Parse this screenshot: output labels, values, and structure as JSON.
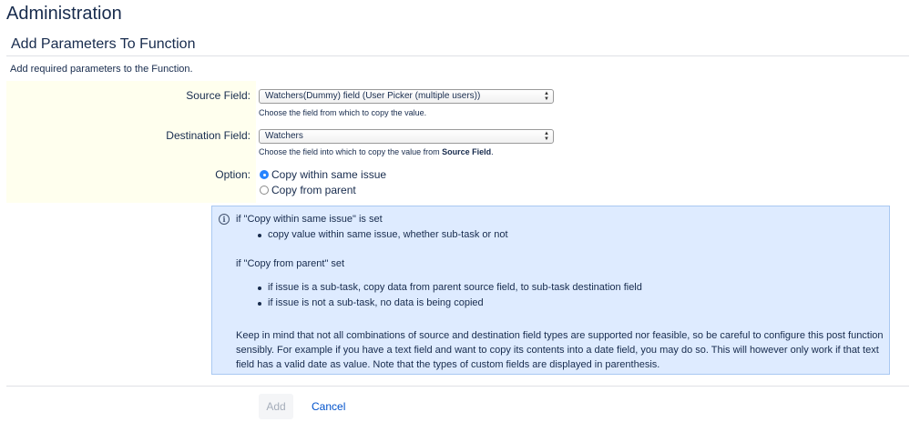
{
  "page": {
    "title": "Administration"
  },
  "section": {
    "title": "Add Parameters To Function",
    "description": "Add required parameters to the Function."
  },
  "form": {
    "source_field": {
      "label": "Source Field:",
      "value": "Watchers(Dummy) field (User Picker (multiple users))",
      "description": "Choose the field from which to copy the value."
    },
    "destination_field": {
      "label": "Destination Field:",
      "value": "Watchers",
      "description_prefix": "Choose the field into which to copy the value from ",
      "description_bold": "Source Field",
      "description_suffix": "."
    },
    "option": {
      "label": "Option:",
      "choices": [
        {
          "label": "Copy within same issue",
          "checked": true
        },
        {
          "label": "Copy from parent",
          "checked": false
        }
      ]
    }
  },
  "info": {
    "heading_same": "if \"Copy within same issue\" is set",
    "bullets_same": [
      "copy value within same issue, whether sub-task or not"
    ],
    "heading_parent": "if \"Copy from parent\" set",
    "bullets_parent": [
      "if issue is a sub-task, copy data from parent source field, to sub-task destination field",
      "if issue is not a sub-task, no data is being copied"
    ],
    "note": "Keep in mind that not all combinations of source and destination field types are supported nor feasible, so be careful to configure this post function sensibly. For example if you have a text field and want to copy its contents into a date field, you may do so. This will however only work if that text field has a valid date as value. Note that the types of custom fields are displayed in parenthesis."
  },
  "actions": {
    "add_label": "Add",
    "cancel_label": "Cancel"
  },
  "colors": {
    "info_bg": "#deebff",
    "param_bg": "#ffffee",
    "link": "#0052cc",
    "radio_checked": "#2684ff"
  }
}
